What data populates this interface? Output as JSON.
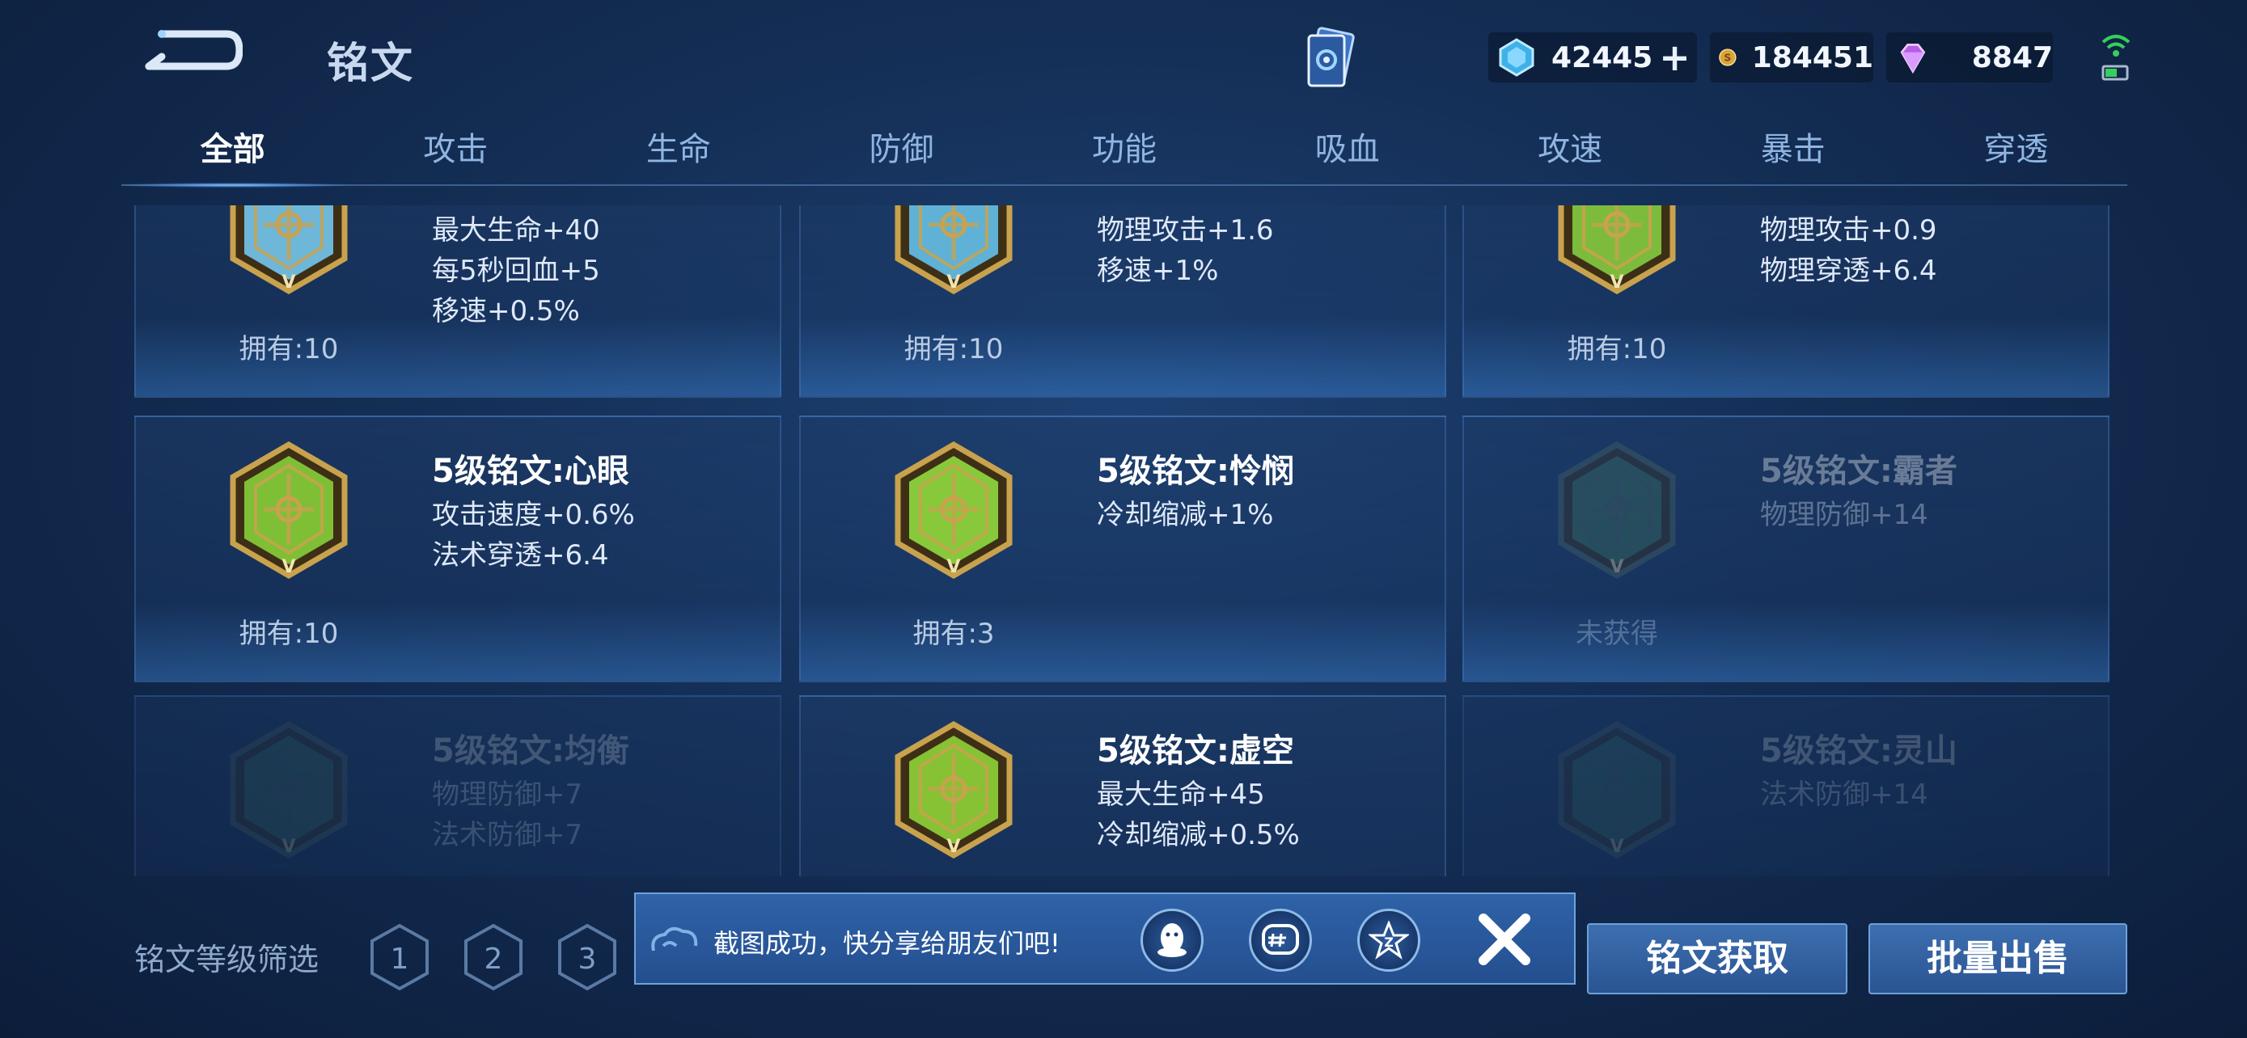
{
  "header": {
    "title": "铭文",
    "currencies": [
      {
        "icon": "diamond-icon",
        "value": "42445"
      },
      {
        "icon": "gold-coin-icon",
        "value": "184451"
      },
      {
        "icon": "purple-gem-icon",
        "value": "8847"
      }
    ],
    "plus_label": "+"
  },
  "tabs": [
    {
      "label": "全部",
      "active": true
    },
    {
      "label": "攻击"
    },
    {
      "label": "生命"
    },
    {
      "label": "防御"
    },
    {
      "label": "功能"
    },
    {
      "label": "吸血"
    },
    {
      "label": "攻速"
    },
    {
      "label": "暴击"
    },
    {
      "label": "穿透"
    }
  ],
  "runes": [
    {
      "name": "",
      "stats": [
        "最大生命+40",
        "每5秒回血+5",
        "移速+0.5%"
      ],
      "owned": "拥有:10",
      "color": "#6fb7d8"
    },
    {
      "name": "",
      "stats": [
        "物理攻击+1.6",
        "移速+1%"
      ],
      "owned": "拥有:10",
      "color": "#5fb2d6"
    },
    {
      "name": "",
      "stats": [
        "物理攻击+0.9",
        "物理穿透+6.4"
      ],
      "owned": "拥有:10",
      "color": "#7dbb3c"
    },
    {
      "name": "5级铭文:心眼",
      "stats": [
        "攻击速度+0.6%",
        "法术穿透+6.4"
      ],
      "owned": "拥有:10",
      "color": "#7fbf36"
    },
    {
      "name": "5级铭文:怜悯",
      "stats": [
        "冷却缩减+1%"
      ],
      "owned": "拥有:3",
      "color": "#88c93b"
    },
    {
      "name": "5级铭文:霸者",
      "stats": [
        "物理防御+14"
      ],
      "owned": "未获得",
      "color": "#3e7a5a"
    },
    {
      "name": "5级铭文:均衡",
      "stats": [
        "物理防御+7",
        "法术防御+7"
      ],
      "owned": "",
      "color": "#3e7a5a"
    },
    {
      "name": "5级铭文:虚空",
      "stats": [
        "最大生命+45",
        "冷却缩减+0.5%"
      ],
      "owned": "",
      "color": "#86c234"
    },
    {
      "name": "5级铭文:灵山",
      "stats": [
        "法术防御+14"
      ],
      "owned": "",
      "color": "#3e7a5a"
    }
  ],
  "filter": {
    "label": "铭文等级筛选",
    "levels": [
      "1",
      "2",
      "3"
    ]
  },
  "toast": {
    "message": "截图成功，快分享给朋友们吧!",
    "share_icons": [
      "qq-icon",
      "wechat-icon",
      "qzone-icon"
    ],
    "close_label": "✕"
  },
  "buttons": {
    "get": "铭文获取",
    "sell": "批量出售"
  }
}
